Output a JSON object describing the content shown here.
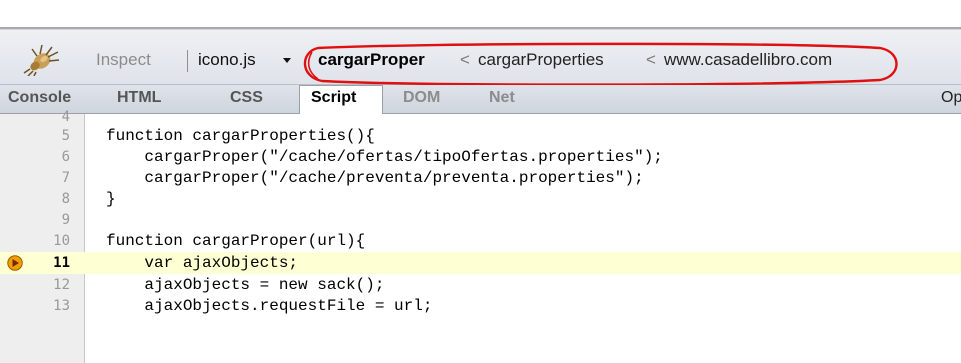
{
  "toolbar": {
    "inspect_label": "Inspect",
    "file_label": "icono.js",
    "breadcrumbs": [
      {
        "label": "cargarProper"
      },
      {
        "label": "cargarProperties"
      },
      {
        "label": "www.casadellibro.com"
      }
    ],
    "breadcrumb_separator": "<"
  },
  "tabs": [
    {
      "label": "Console"
    },
    {
      "label": "HTML"
    },
    {
      "label": "CSS"
    },
    {
      "label": "Script"
    },
    {
      "label": "DOM"
    },
    {
      "label": "Net"
    },
    {
      "label": "Op"
    }
  ],
  "code": {
    "lines": [
      {
        "number": "4",
        "text": ""
      },
      {
        "number": "5",
        "text": "function cargarProperties(){"
      },
      {
        "number": "6",
        "text": "    cargarProper(\"/cache/ofertas/tipoOfertas.properties\");"
      },
      {
        "number": "7",
        "text": "    cargarProper(\"/cache/preventa/preventa.properties\");"
      },
      {
        "number": "8",
        "text": "}"
      },
      {
        "number": "9",
        "text": ""
      },
      {
        "number": "10",
        "text": "function cargarProper(url){"
      },
      {
        "number": "11",
        "text": "    var ajaxObjects;"
      },
      {
        "number": "12",
        "text": "    ajaxObjects = new sack();"
      },
      {
        "number": "13",
        "text": "    ajaxObjects.requestFile = url;"
      }
    ]
  },
  "colors": {
    "highlight_line": "#ffffd4",
    "annotation_oval": "#e01010",
    "breakpoint": "#f0a000"
  }
}
